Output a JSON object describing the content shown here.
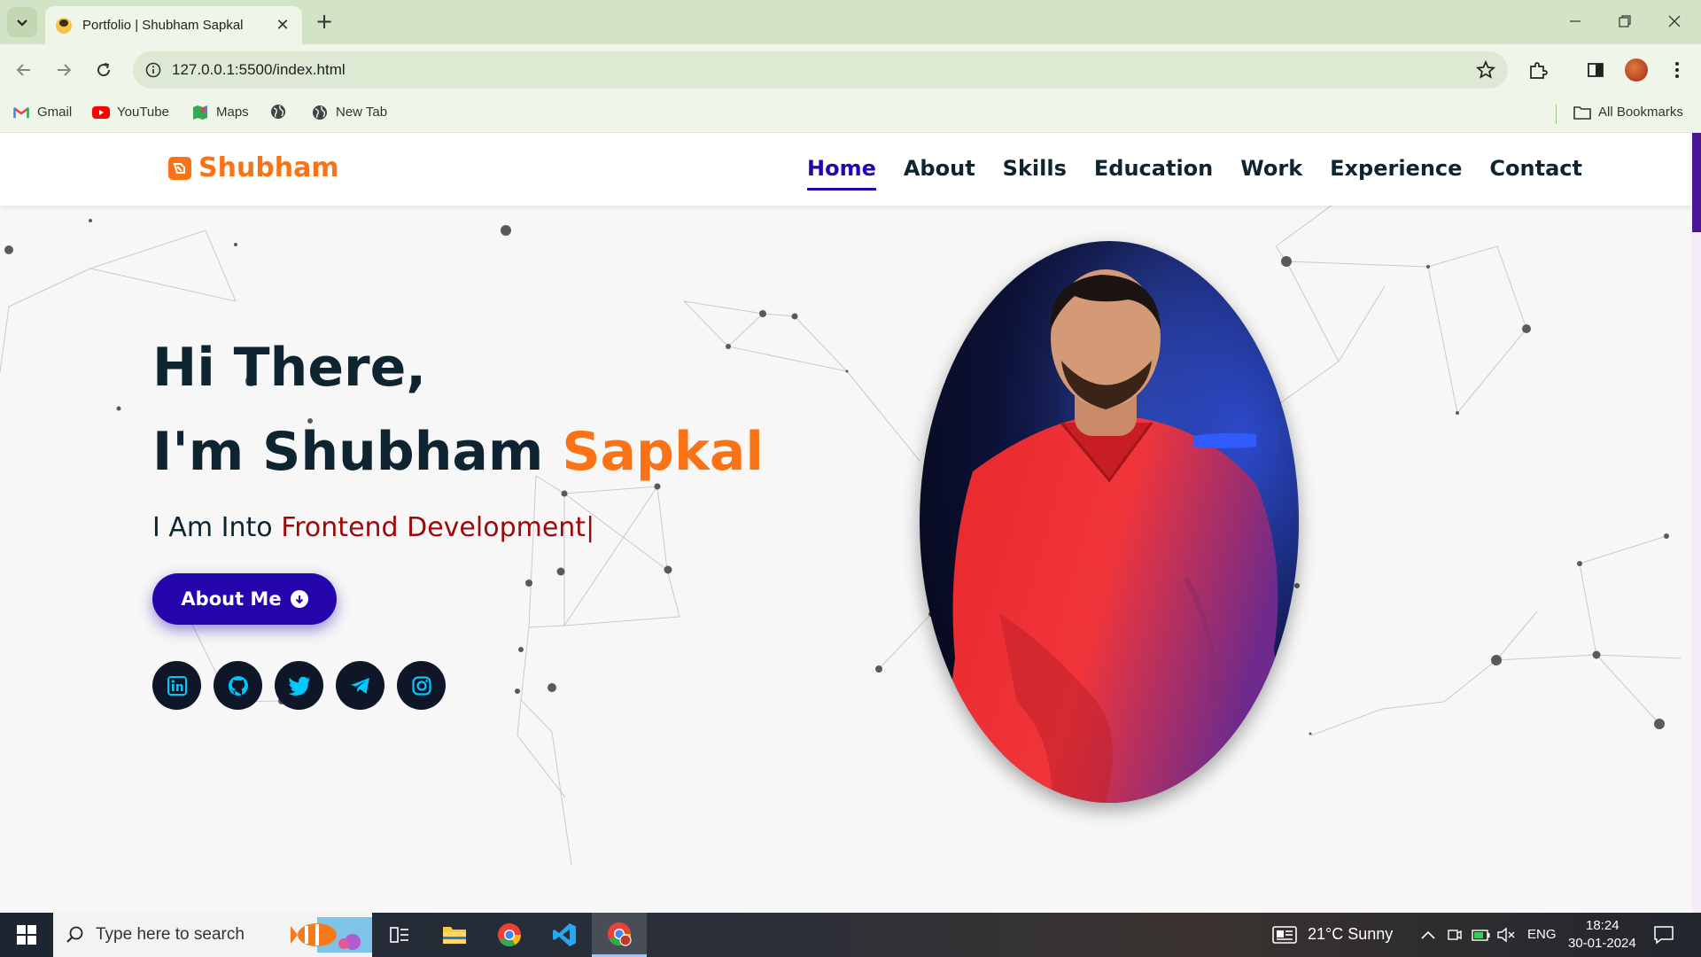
{
  "browser": {
    "tab_title": "Portfolio | Shubham Sapkal",
    "url": "127.0.0.1:5500/index.html",
    "bookmarks": [
      {
        "label": "Gmail",
        "icon": "gmail-icon"
      },
      {
        "label": "YouTube",
        "icon": "youtube-icon"
      },
      {
        "label": "Maps",
        "icon": "maps-icon"
      },
      {
        "label": "",
        "icon": "globe-icon"
      },
      {
        "label": "New Tab",
        "icon": "globe-icon"
      }
    ],
    "all_bookmarks": "All Bookmarks"
  },
  "site": {
    "logo": "Shubham",
    "nav": [
      "Home",
      "About",
      "Skills",
      "Education",
      "Work",
      "Experience",
      "Contact"
    ],
    "active_nav": "Home",
    "hero": {
      "line1": "Hi There,",
      "name_first": "I'm Shubham ",
      "name_accent": "Sapkal",
      "into_prefix": "I Am Into ",
      "into_typed": "Frontend Development|",
      "button": "About Me"
    },
    "socials": [
      "linkedin-icon",
      "github-icon",
      "twitter-icon",
      "telegram-icon",
      "instagram-icon"
    ],
    "colors": {
      "accent": "#f97316",
      "primary": "#2506ad",
      "dark": "#0e2431",
      "typed": "#9b0a0a",
      "social_icon": "#00c8ff"
    }
  },
  "taskbar": {
    "search_placeholder": "Type here to search",
    "weather": "21°C  Sunny",
    "language": "ENG",
    "time": "18:24",
    "date": "30-01-2024"
  }
}
